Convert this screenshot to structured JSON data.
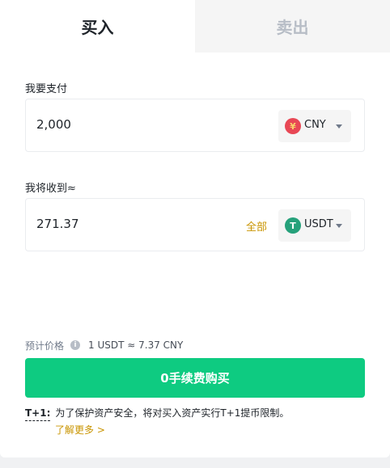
{
  "tabs": {
    "buy": "买入",
    "sell": "卖出"
  },
  "pay": {
    "label": "我要支付",
    "value": "2,000",
    "currency": "CNY",
    "coin_icon_char": "¥"
  },
  "receive": {
    "label": "我将收到≈",
    "value": "271.37",
    "all_label": "全部",
    "currency": "USDT",
    "coin_icon_char": "T"
  },
  "price": {
    "label": "预计价格",
    "info_char": "i",
    "value": "1 USDT ≈ 7.37 CNY"
  },
  "buy_button": {
    "label": "0手续费购买"
  },
  "notice": {
    "tag": "T+1:",
    "text": "为了保护资产安全，将对买入资产实行T+1提币限制。",
    "learn_more": "了解更多 >"
  },
  "colors": {
    "accent_green": "#0ecb81",
    "link_gold": "#c99400",
    "cny_red": "#e84855",
    "usdt_green": "#26a17b"
  }
}
